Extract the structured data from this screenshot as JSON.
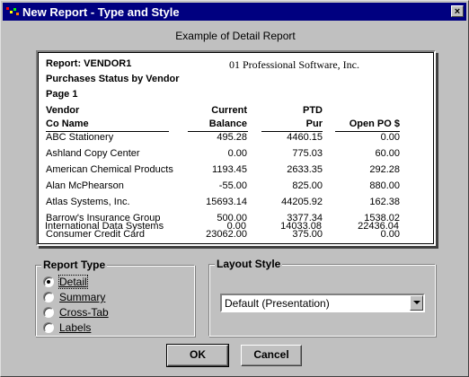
{
  "window": {
    "title": "New Report - Type and Style",
    "close_glyph": "×"
  },
  "example": {
    "caption": "Example of Detail Report",
    "report_label": "Report: VENDOR1",
    "company": "01 Professional Software, Inc.",
    "report_title": "Purchases Status by Vendor",
    "page": "Page 1",
    "columns": {
      "vendor_line1": "Vendor",
      "vendor_line2": "Co Name",
      "balance_line1": "Current",
      "balance_line2": "Balance",
      "ptd_line1": "PTD",
      "ptd_line2": "Pur",
      "openpo": "Open PO $"
    },
    "rows": [
      {
        "name": "ABC Stationery",
        "balance": "495.28",
        "ptd": "4460.15",
        "openpo": "0.00"
      },
      {
        "name": "Ashland Copy Center",
        "balance": "0.00",
        "ptd": "775.03",
        "openpo": "60.00"
      },
      {
        "name": "American Chemical Products",
        "balance": "1193.45",
        "ptd": "2633.35",
        "openpo": "292.28"
      },
      {
        "name": "Alan McPhearson",
        "balance": "-55.00",
        "ptd": "825.00",
        "openpo": "880.00"
      },
      {
        "name": "Atlas Systems, Inc.",
        "balance": "15693.14",
        "ptd": "44205.92",
        "openpo": "162.38"
      },
      {
        "name": "Barrow's Insurance Group",
        "balance": "500.00",
        "ptd": "3377.34",
        "openpo": "1538.02"
      },
      {
        "name": "Consumer Credit Card",
        "balance": "23062.00",
        "ptd": "375.00",
        "openpo": "0.00"
      },
      {
        "name": "International Data Systems",
        "balance": "0.00",
        "ptd": "14033.08",
        "openpo": "22436.04"
      }
    ]
  },
  "report_type": {
    "title": "Report Type",
    "selected": "Detail",
    "options": [
      "Detail",
      "Summary",
      "Cross-Tab",
      "Labels"
    ]
  },
  "layout_style": {
    "title": "Layout Style",
    "value": "Default (Presentation)"
  },
  "buttons": {
    "ok": "OK",
    "cancel": "Cancel"
  },
  "colors": {
    "face": "#c0c0c0",
    "titlebar": "#000080"
  }
}
